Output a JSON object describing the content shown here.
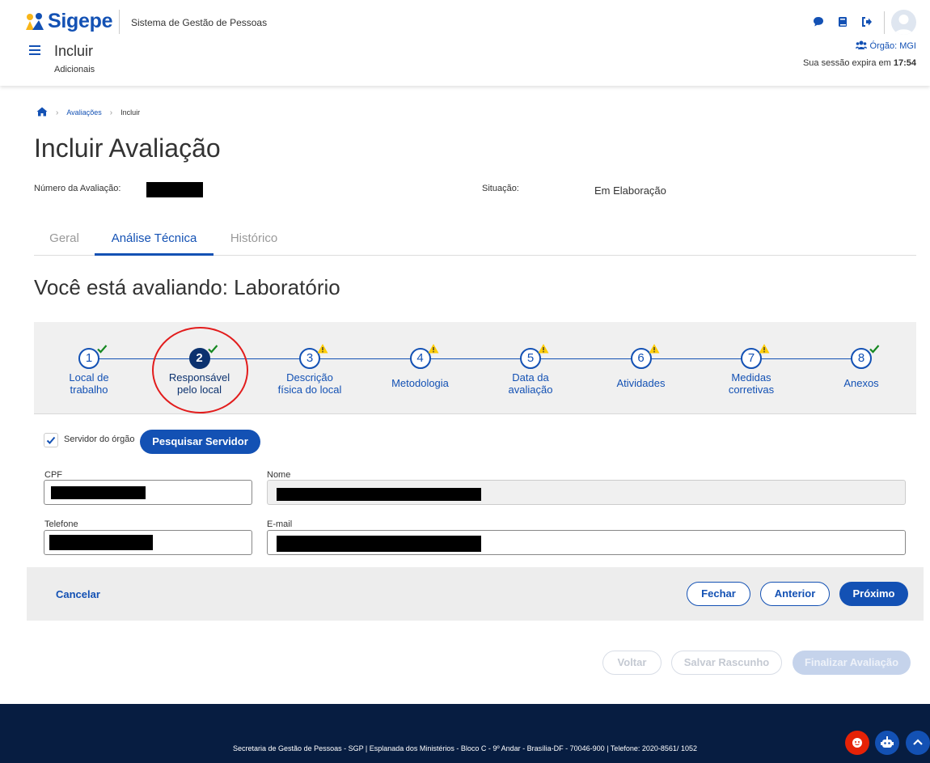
{
  "header": {
    "logo": "Sigepe",
    "system_name": "Sistema de Gestão de Pessoas",
    "title": "Incluir",
    "subtitle": "Adicionais",
    "orgao": "Órgão: MGI",
    "session_prefix": "Sua sessão expira em",
    "session_time": "17:54",
    "icons": [
      "chat-icon",
      "book-icon",
      "logout-icon",
      "user-avatar",
      "users-icon"
    ]
  },
  "breadcrumb": {
    "items": [
      "Avaliações",
      "Incluir"
    ]
  },
  "page_title": "Incluir Avaliação",
  "info": {
    "numero_label": "Número da Avaliação:",
    "situacao_label": "Situação:",
    "situacao_value": "Em Elaboração"
  },
  "tabs": [
    {
      "label": "Geral",
      "active": false
    },
    {
      "label": "Análise Técnica",
      "active": true
    },
    {
      "label": "Histórico",
      "active": false
    }
  ],
  "evaluating": "Você está avaliando: Laboratório",
  "steps": [
    {
      "number": "1",
      "line1": "Local de",
      "line2": "trabalho",
      "status": "ok"
    },
    {
      "number": "2",
      "line1": "Responsável",
      "line2": "pelo local",
      "status": "ok"
    },
    {
      "number": "3",
      "line1": "Descrição",
      "line2": "física do local",
      "status": "warning"
    },
    {
      "number": "4",
      "line1": "Metodologia",
      "line2": "",
      "status": "warning"
    },
    {
      "number": "5",
      "line1": "Data da",
      "line2": "avaliação",
      "status": "warning"
    },
    {
      "number": "6",
      "line1": "Atividades",
      "line2": "",
      "status": "warning"
    },
    {
      "number": "7",
      "line1": "Medidas",
      "line2": "corretivas",
      "status": "warning"
    },
    {
      "number": "8",
      "line1": "Anexos",
      "line2": "",
      "status": "ok"
    }
  ],
  "current_step": "2",
  "colors": {
    "primary": "#1351b4",
    "current_step": "#0c326f",
    "ok": "#168821",
    "warning": "#ffcd07",
    "highlight": "#e21c1c",
    "footer": "#071d41"
  },
  "form": {
    "servidor_label": "Servidor do órgão",
    "servidor_checked": true,
    "search_button": "Pesquisar Servidor",
    "cpf_label": "CPF",
    "nome_label": "Nome",
    "telefone_label": "Telefone",
    "email_label": "E-mail"
  },
  "actions": {
    "cancel": "Cancelar",
    "close": "Fechar",
    "previous": "Anterior",
    "next": "Próximo"
  },
  "bottom_actions": {
    "back": "Voltar",
    "save_draft": "Salvar Rascunho",
    "finalize": "Finalizar Avaliação"
  },
  "footer": {
    "text": "Secretaria de Gestão de Pessoas - SGP | Esplanada dos Ministérios - Bloco C - 9º Andar - Brasília-DF - 70046-900 | Telefone: 2020-8561/ 1052"
  }
}
